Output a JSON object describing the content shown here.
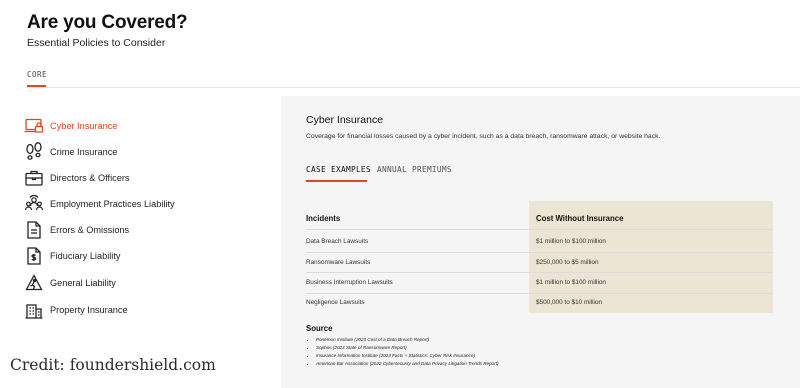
{
  "header": {
    "title": "Are you Covered?",
    "subtitle": "Essential Policies to Consider"
  },
  "top_tab": {
    "label": "CORE"
  },
  "accent_color": "#e8431a",
  "sidebar": {
    "items": [
      {
        "label": "Cyber Insurance",
        "icon": "laptop-lock-icon",
        "active": true
      },
      {
        "label": "Crime Insurance",
        "icon": "footprints-icon",
        "active": false
      },
      {
        "label": "Directors & Officers",
        "icon": "briefcase-icon",
        "active": false
      },
      {
        "label": "Employment Practices Liability",
        "icon": "people-group-icon",
        "active": false
      },
      {
        "label": "Errors & Omissions",
        "icon": "document-icon",
        "active": false
      },
      {
        "label": "Fiduciary Liability",
        "icon": "money-document-icon",
        "active": false
      },
      {
        "label": "General Liability",
        "icon": "caution-icon",
        "active": false
      },
      {
        "label": "Property Insurance",
        "icon": "building-icon",
        "active": false
      }
    ]
  },
  "panel": {
    "title": "Cyber Insurance",
    "description": "Coverage for financial losses caused by a cyber incident, such as a data breach, ransomware attack, or website hack.",
    "tabs": [
      {
        "label": "CASE EXAMPLES",
        "active": true
      },
      {
        "label": "ANNUAL PREMIUMS",
        "active": false
      }
    ],
    "table": {
      "headers": [
        "Incidents",
        "Cost Without Insurance"
      ],
      "rows": [
        [
          "Data Breach Lawsuits",
          "$1 million to $100 million"
        ],
        [
          "Ransomware Lawsuits",
          "$250,000 to $5 million"
        ],
        [
          "Business Interruption Lawsuits",
          "$1 million to $100 million"
        ],
        [
          "Negligence Lawsuits",
          "$500,000 to $10 million"
        ]
      ]
    },
    "source": {
      "title": "Source",
      "items": [
        "Ponemon Institute (2023 Cost of a Data Breach Report)",
        "Sophos (2023 State of Ransomware Report)",
        "Insurance Information Institute (2023 Facts + Statistics: Cyber Risk Insurance)",
        "American Bar Association (2022 Cybersecurity and Data Privacy Litigation Trends Report)"
      ]
    }
  },
  "credit": "Credit: foundershield.com"
}
